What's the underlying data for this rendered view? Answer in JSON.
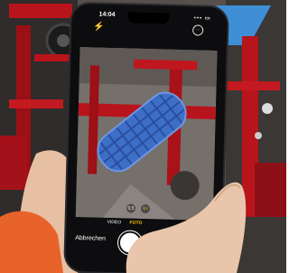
{
  "status_bar": {
    "time": "14:04",
    "signal": "▪▪▪ ▭"
  },
  "camera": {
    "flash_glyph": "⚡",
    "options_glyph": "···",
    "zoom_levels": [
      "0,5",
      "1×"
    ],
    "modes": [
      "VIDEO",
      "FOTO"
    ],
    "selected_mode": "FOTO",
    "cancel_label": "Abbrechen"
  },
  "colors": {
    "machine_red": "#b8141c",
    "filter_blue": "#3d6fc7",
    "jacket_orange": "#e8632a",
    "mode_highlight": "#ffcc00"
  }
}
